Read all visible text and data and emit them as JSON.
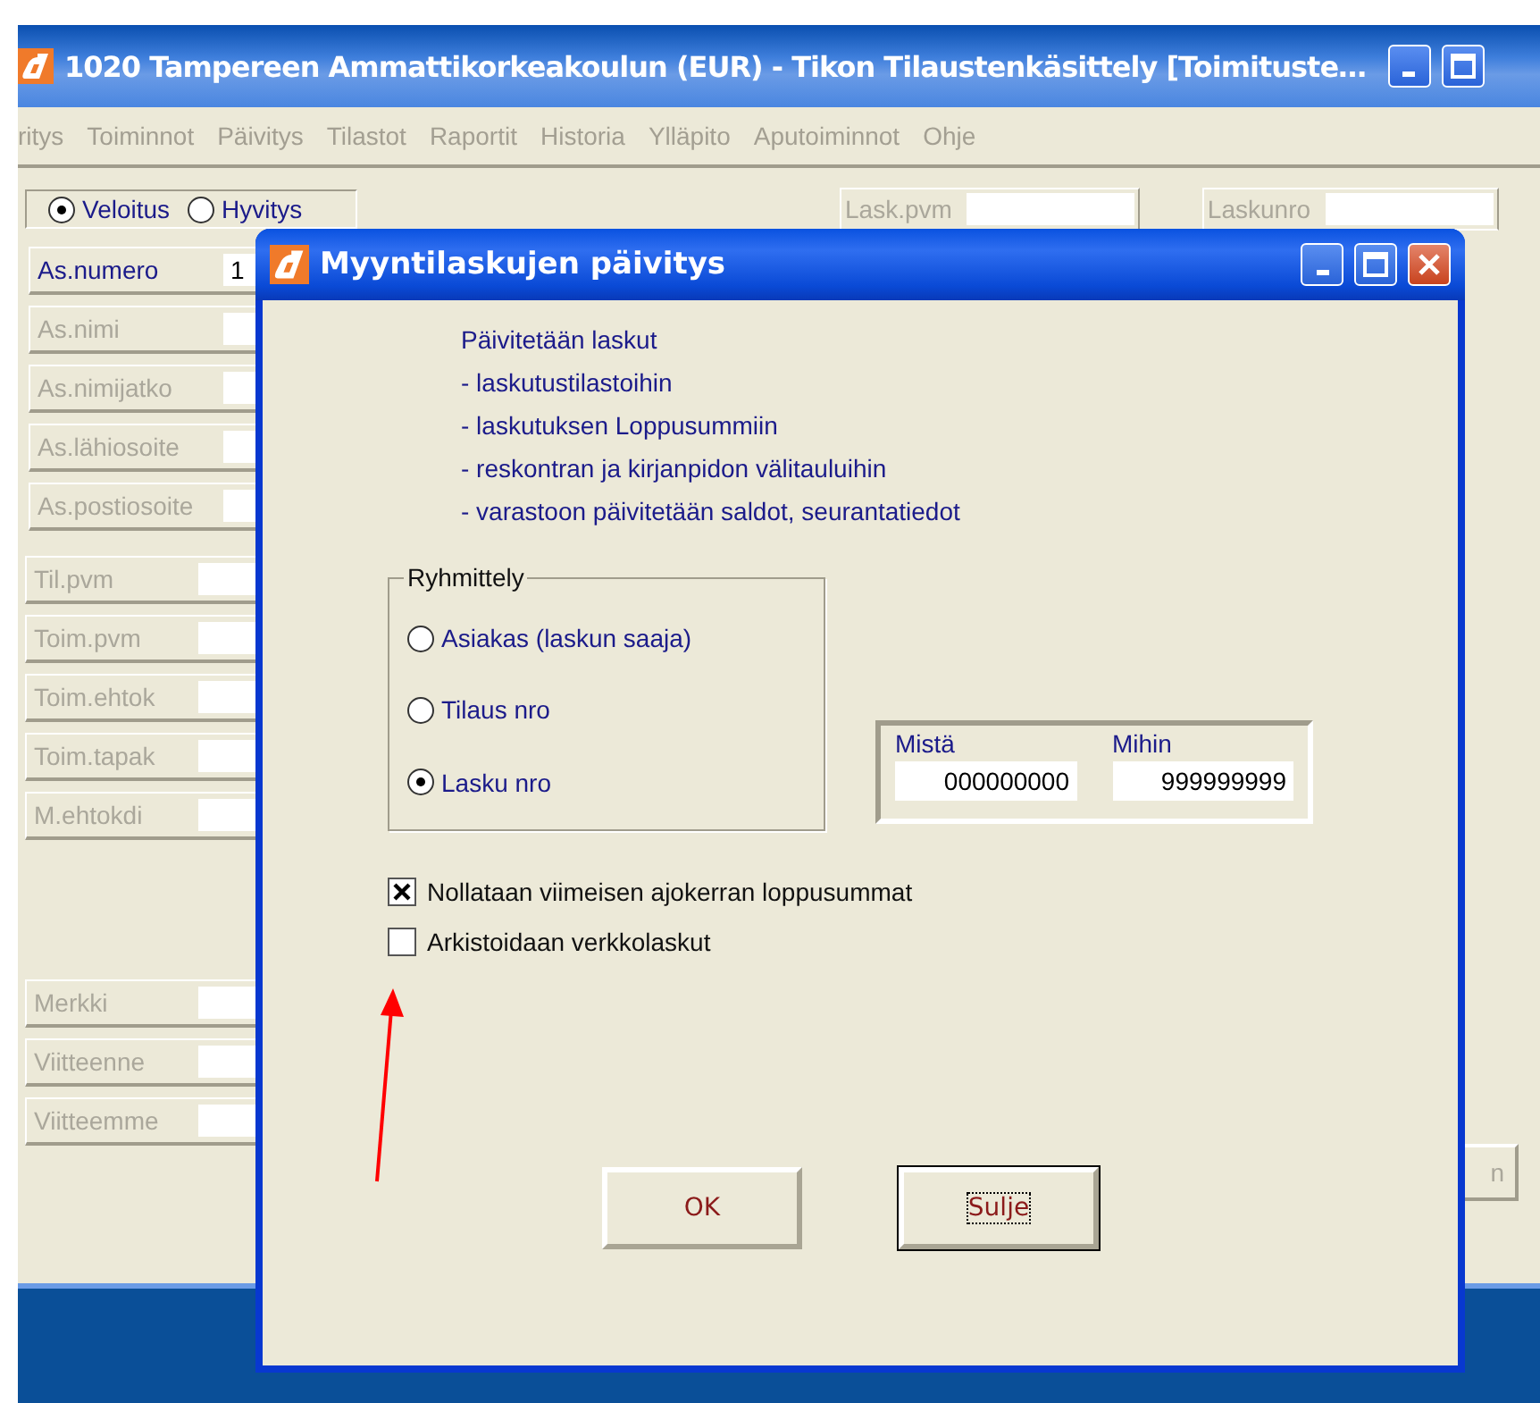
{
  "window": {
    "title": "1020  Tampereen Ammattikorkeakoulun (EUR)  - Tikon Tilaustenkäsittely [Toimituste…"
  },
  "menu": [
    "ritys",
    "Toiminnot",
    "Päivitys",
    "Tilastot",
    "Raportit",
    "Historia",
    "Ylläpito",
    "Aputoiminnot",
    "Ohje"
  ],
  "type_radios": [
    {
      "label": "Veloitus",
      "selected": true
    },
    {
      "label": "Hyvitys",
      "selected": false
    }
  ],
  "top_fields": [
    {
      "label": "Lask.pvm",
      "disabled": true
    },
    {
      "label": "Laskunro",
      "disabled": true
    }
  ],
  "customer_fields": [
    {
      "label": "As.numero",
      "value": "1",
      "disabled": false
    },
    {
      "label": "As.nimi",
      "disabled": true
    },
    {
      "label": "As.nimijatko",
      "disabled": true
    },
    {
      "label": "As.lähiosoite",
      "disabled": true
    },
    {
      "label": "As.postiosoite",
      "disabled": true
    }
  ],
  "delivery_fields": [
    {
      "label": "Til.pvm",
      "disabled": true
    },
    {
      "label": "Toim.pvm",
      "disabled": true
    },
    {
      "label": "Toim.ehtok",
      "disabled": true
    },
    {
      "label": "Toim.tapak",
      "disabled": true
    },
    {
      "label": "M.ehtokdi",
      "disabled": true
    }
  ],
  "reference_fields": [
    {
      "label": "Merkki",
      "disabled": true
    },
    {
      "label": "Viitteenne",
      "disabled": true
    },
    {
      "label": "Viitteemme",
      "disabled": true
    }
  ],
  "background_button": {
    "label": "n",
    "disabled": true
  },
  "dialog": {
    "title": "Myyntilaskujen päivitys",
    "message": [
      "Päivitetään laskut",
      "- laskutustilastoihin",
      "- laskutuksen Loppusummiin",
      "- reskontran ja kirjanpidon välitauluihin",
      "- varastoon päivitetään saldot, seurantatiedot"
    ],
    "grouping": {
      "title": "Ryhmittely",
      "options": [
        {
          "label": "Asiakas (laskun saaja)",
          "selected": false
        },
        {
          "label": "Tilaus nro",
          "selected": false
        },
        {
          "label": "Lasku nro",
          "selected": true
        }
      ]
    },
    "range": [
      {
        "label": "Mistä",
        "value": "000000000"
      },
      {
        "label": "Mihin",
        "value": "999999999"
      }
    ],
    "checkboxes": [
      {
        "label": "Nollataan viimeisen ajokerran loppusummat",
        "checked": true
      },
      {
        "label": "Arkistoidaan verkkolaskut",
        "checked": false
      }
    ],
    "buttons": [
      {
        "label": "OK",
        "focused": false
      },
      {
        "label": "Sulje",
        "focused": true
      }
    ]
  }
}
